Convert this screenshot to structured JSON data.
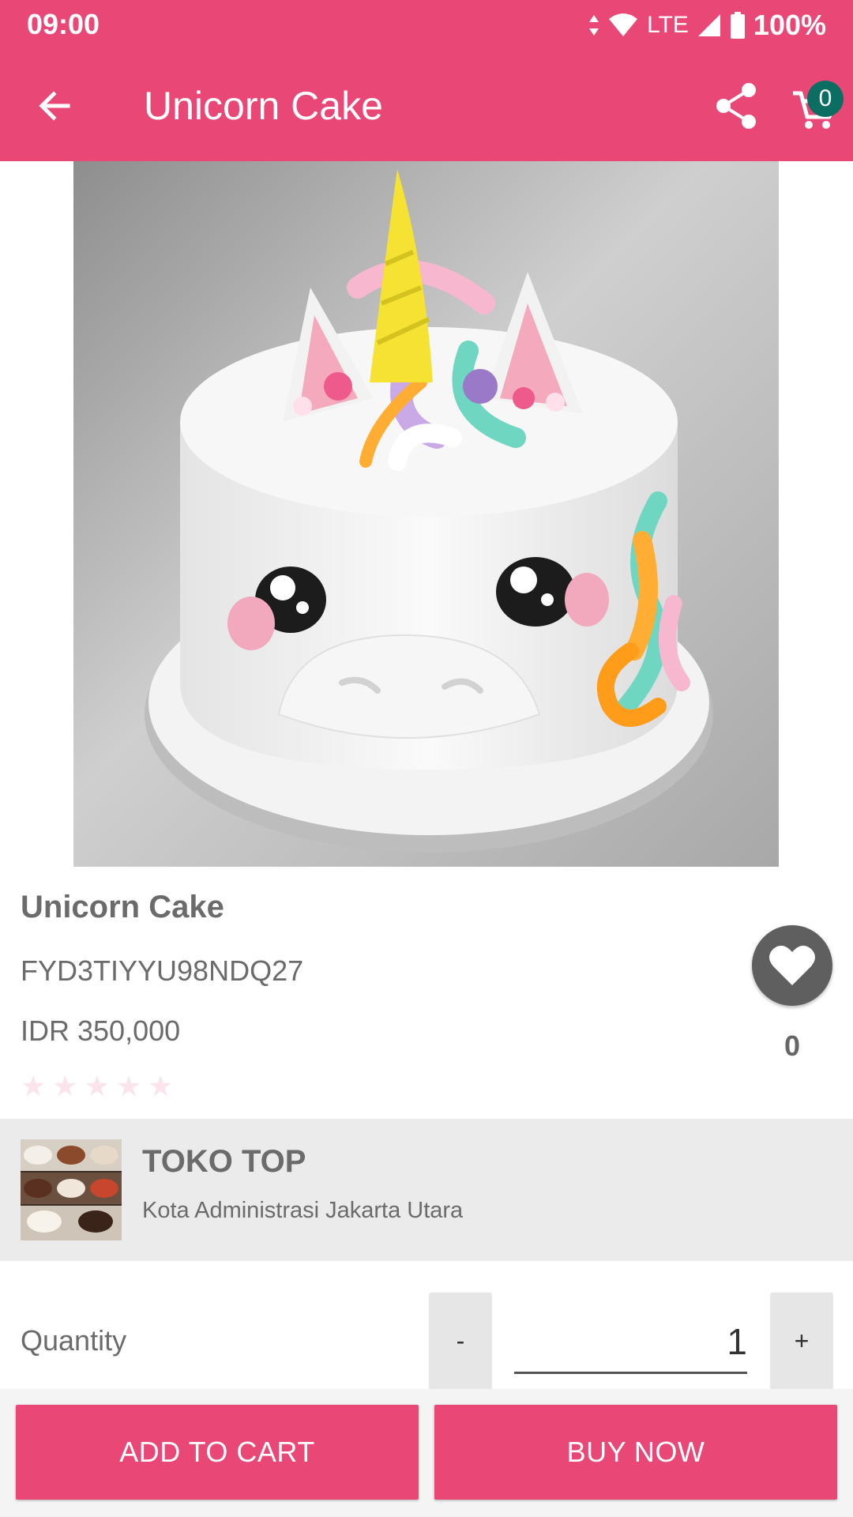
{
  "status_bar": {
    "time": "09:00",
    "network": "LTE",
    "battery": "100%"
  },
  "app_bar": {
    "title": "Unicorn Cake",
    "cart_count": "0"
  },
  "product": {
    "name": "Unicorn Cake",
    "code": "FYD3TIYYU98NDQ27",
    "price": "IDR 350,000",
    "rating": 0,
    "rating_max": 5,
    "favorite_count": "0"
  },
  "store": {
    "name": "TOKO TOP",
    "location": "Kota Administrasi Jakarta Utara"
  },
  "quantity": {
    "label": "Quantity",
    "value": "1",
    "minus": "-",
    "plus": "+"
  },
  "actions": {
    "add_to_cart": "ADD TO CART",
    "buy_now": "BUY NOW"
  },
  "colors": {
    "primary": "#e94876",
    "badge": "#0c6d63",
    "store_bg": "#ebebeb"
  }
}
